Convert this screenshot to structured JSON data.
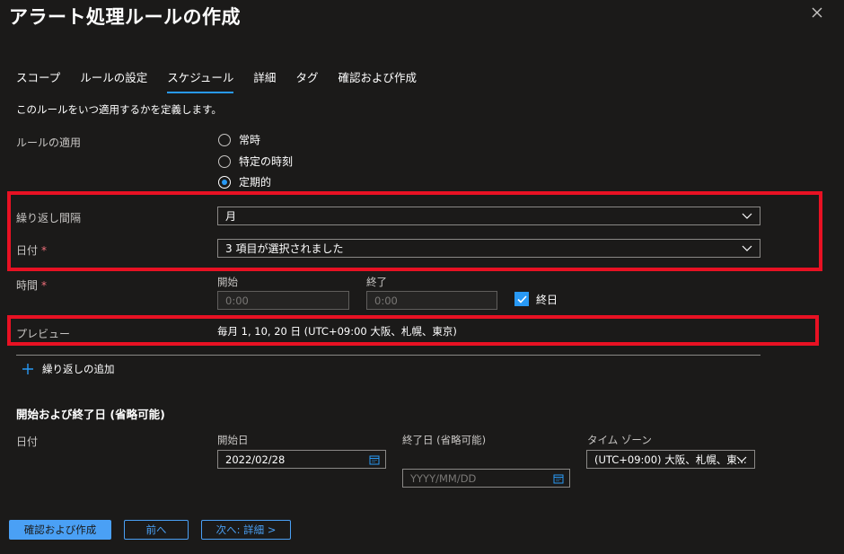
{
  "header": {
    "title": "アラート処理ルールの作成",
    "more": "···"
  },
  "tabs": [
    {
      "label": "スコープ"
    },
    {
      "label": "ルールの設定"
    },
    {
      "label": "スケジュール",
      "active": true
    },
    {
      "label": "詳細"
    },
    {
      "label": "タグ"
    },
    {
      "label": "確認および作成"
    }
  ],
  "description": "このルールをいつ適用するかを定義します。",
  "apply": {
    "label": "ルールの適用",
    "options": [
      "常時",
      "特定の時刻",
      "定期的"
    ],
    "selected": "定期的"
  },
  "recurrence": {
    "label": "繰り返し間隔",
    "value": "月"
  },
  "date": {
    "label": "日付",
    "required": "*",
    "value": "3 項目が選択されました"
  },
  "time": {
    "label": "時間",
    "required": "*",
    "start_label": "開始",
    "start_value": "0:00",
    "end_label": "終了",
    "end_value": "0:00",
    "allday_label": "終日",
    "allday_checked": true
  },
  "preview": {
    "label": "プレビュー",
    "value": "毎月 1, 10, 20 日 (UTC+09:00 大阪、札幌、東京)"
  },
  "add_recurrence": {
    "icon": "plus-icon",
    "label": "繰り返しの追加"
  },
  "date_range": {
    "title": "開始および終了日 (省略可能)",
    "row_label": "日付",
    "start_label": "開始日",
    "start_value": "2022/02/28",
    "end_label": "終了日 (省略可能)",
    "end_placeholder": "YYYY/MM/DD",
    "tz_label": "タイム ゾーン",
    "tz_value": "(UTC+09:00) 大阪、札幌、東..."
  },
  "footer": {
    "review": "確認および作成",
    "prev": "前へ",
    "next": "次へ: 詳細 >"
  },
  "colors": {
    "accent": "#2899f5",
    "highlight": "#e81123",
    "background": "#1b1a19"
  }
}
